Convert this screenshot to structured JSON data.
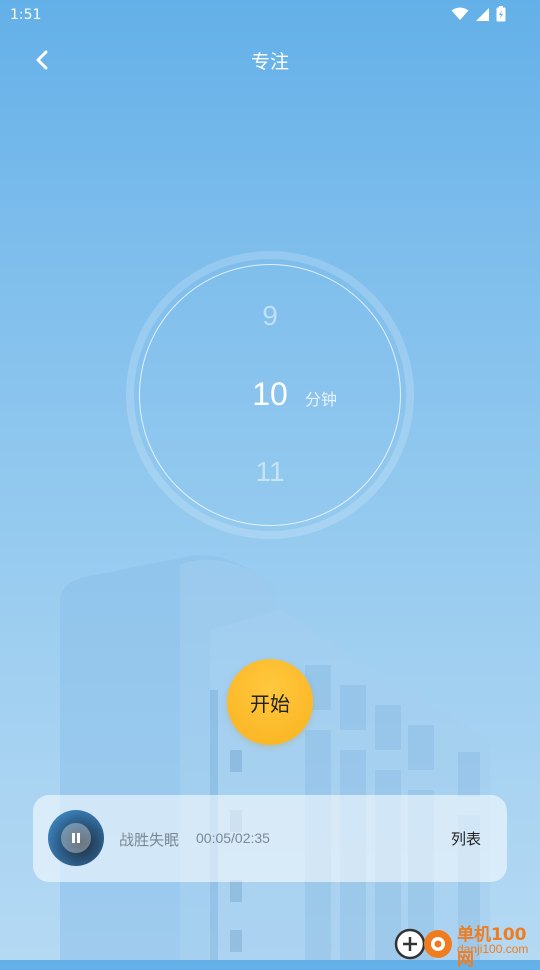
{
  "status_bar": {
    "time": "1:51",
    "icons": [
      "wifi-icon",
      "signal-icon",
      "battery-charging-icon"
    ]
  },
  "header": {
    "title": "专注",
    "back_icon": "chevron-left-icon"
  },
  "dial": {
    "prev": "9",
    "current": "10",
    "next": "11",
    "unit": "分钟"
  },
  "start_button": {
    "label": "开始"
  },
  "player": {
    "title": "战胜失眠",
    "time": "00:05/02:35",
    "list_label": "列表",
    "state_icon": "pause-icon"
  },
  "watermark": {
    "text": "单机100网",
    "url": "danji100.com"
  },
  "colors": {
    "accent": "#f9b21f",
    "background_top": "#63b0e8",
    "background_bottom": "#b4d9f3"
  }
}
